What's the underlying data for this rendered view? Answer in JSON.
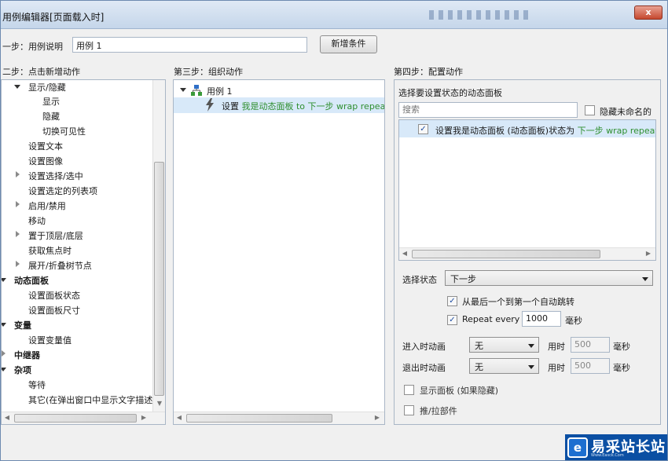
{
  "window": {
    "title": "用例编辑器[页面载入时]",
    "close_label": "x"
  },
  "top": {
    "step1_label": "一步：用例说明",
    "case_name_value": "用例 1",
    "add_condition_label": "新增条件"
  },
  "step2": {
    "title": "二步：点击新增动作",
    "items": [
      {
        "label": "显示/隐藏"
      },
      {
        "label": "显示"
      },
      {
        "label": "隐藏"
      },
      {
        "label": "切换可见性"
      },
      {
        "label": "设置文本"
      },
      {
        "label": "设置图像"
      },
      {
        "label": "设置选择/选中"
      },
      {
        "label": "设置选定的列表项"
      },
      {
        "label": "启用/禁用"
      },
      {
        "label": "移动"
      },
      {
        "label": "置于顶层/底层"
      },
      {
        "label": "获取焦点时"
      },
      {
        "label": "展开/折叠树节点"
      },
      {
        "label": "动态面板"
      },
      {
        "label": "设置面板状态"
      },
      {
        "label": "设置面板尺寸"
      },
      {
        "label": "变量"
      },
      {
        "label": "设置变量值"
      },
      {
        "label": "中继器"
      },
      {
        "label": "杂项"
      },
      {
        "label": "等待"
      },
      {
        "label": "其它(在弹出窗口中显示文字描述"
      }
    ]
  },
  "step3": {
    "title": "第三步：组织动作",
    "case_label": "用例 1",
    "action_prefix": "设置",
    "action_detail": "我是动态面板 to 下一步 wrap repeat"
  },
  "step4": {
    "title": "第四步：配置动作",
    "subtitle": "选择要设置状态的动态面板",
    "search_placeholder": "搜索",
    "hide_unnamed_label": "隐藏未命名的",
    "panel_row_prefix": "设置我是动态面板 (动态面板)状态为",
    "panel_row_value": "下一步 wrap repeat",
    "select_state_label": "选择状态",
    "select_state_value": "下一步",
    "wrap_label": "从最后一个到第一个自动跳转",
    "repeat_label": "Repeat every",
    "repeat_value": "1000",
    "ms_label": "毫秒",
    "enter_anim_label": "进入时动画",
    "enter_anim_value": "无",
    "exit_anim_label": "退出时动画",
    "exit_anim_value": "无",
    "time_label": "用时",
    "enter_time_value": "500",
    "exit_time_value": "500",
    "show_panel_label": "显示面板 (如果隐藏)",
    "push_pull_label": "推/拉部件"
  },
  "watermark": {
    "logo_char": "e",
    "logo_name": "易采站长站",
    "logo_sub": "Www.Easck.Com"
  }
}
